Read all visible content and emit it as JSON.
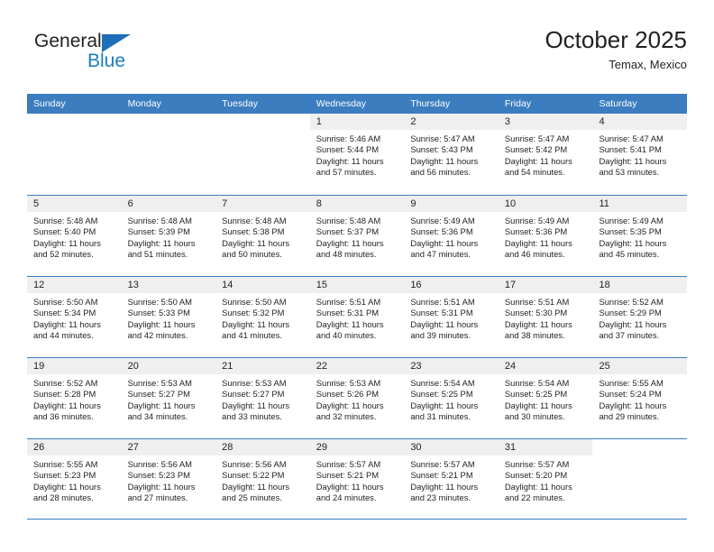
{
  "logo": {
    "word_one": "General",
    "word_two": "Blue",
    "icon": "triangle-icon",
    "brand_color": "#1a7fc1"
  },
  "header": {
    "title": "October 2025",
    "subtitle": "Temax, Mexico"
  },
  "theme": {
    "header_blue": "#3b7dbf",
    "daynum_band": "#efefef",
    "text": "#231f20"
  },
  "calendar": {
    "weekdays": [
      "Sunday",
      "Monday",
      "Tuesday",
      "Wednesday",
      "Thursday",
      "Friday",
      "Saturday"
    ],
    "weeks": [
      [
        {
          "day": "",
          "empty": true
        },
        {
          "day": "",
          "empty": true
        },
        {
          "day": "",
          "empty": true
        },
        {
          "day": "1",
          "sunrise": "Sunrise: 5:46 AM",
          "sunset": "Sunset: 5:44 PM",
          "daylight_1": "Daylight: 11 hours",
          "daylight_2": "and 57 minutes."
        },
        {
          "day": "2",
          "sunrise": "Sunrise: 5:47 AM",
          "sunset": "Sunset: 5:43 PM",
          "daylight_1": "Daylight: 11 hours",
          "daylight_2": "and 56 minutes."
        },
        {
          "day": "3",
          "sunrise": "Sunrise: 5:47 AM",
          "sunset": "Sunset: 5:42 PM",
          "daylight_1": "Daylight: 11 hours",
          "daylight_2": "and 54 minutes."
        },
        {
          "day": "4",
          "sunrise": "Sunrise: 5:47 AM",
          "sunset": "Sunset: 5:41 PM",
          "daylight_1": "Daylight: 11 hours",
          "daylight_2": "and 53 minutes."
        }
      ],
      [
        {
          "day": "5",
          "sunrise": "Sunrise: 5:48 AM",
          "sunset": "Sunset: 5:40 PM",
          "daylight_1": "Daylight: 11 hours",
          "daylight_2": "and 52 minutes."
        },
        {
          "day": "6",
          "sunrise": "Sunrise: 5:48 AM",
          "sunset": "Sunset: 5:39 PM",
          "daylight_1": "Daylight: 11 hours",
          "daylight_2": "and 51 minutes."
        },
        {
          "day": "7",
          "sunrise": "Sunrise: 5:48 AM",
          "sunset": "Sunset: 5:38 PM",
          "daylight_1": "Daylight: 11 hours",
          "daylight_2": "and 50 minutes."
        },
        {
          "day": "8",
          "sunrise": "Sunrise: 5:48 AM",
          "sunset": "Sunset: 5:37 PM",
          "daylight_1": "Daylight: 11 hours",
          "daylight_2": "and 48 minutes."
        },
        {
          "day": "9",
          "sunrise": "Sunrise: 5:49 AM",
          "sunset": "Sunset: 5:36 PM",
          "daylight_1": "Daylight: 11 hours",
          "daylight_2": "and 47 minutes."
        },
        {
          "day": "10",
          "sunrise": "Sunrise: 5:49 AM",
          "sunset": "Sunset: 5:36 PM",
          "daylight_1": "Daylight: 11 hours",
          "daylight_2": "and 46 minutes."
        },
        {
          "day": "11",
          "sunrise": "Sunrise: 5:49 AM",
          "sunset": "Sunset: 5:35 PM",
          "daylight_1": "Daylight: 11 hours",
          "daylight_2": "and 45 minutes."
        }
      ],
      [
        {
          "day": "12",
          "sunrise": "Sunrise: 5:50 AM",
          "sunset": "Sunset: 5:34 PM",
          "daylight_1": "Daylight: 11 hours",
          "daylight_2": "and 44 minutes."
        },
        {
          "day": "13",
          "sunrise": "Sunrise: 5:50 AM",
          "sunset": "Sunset: 5:33 PM",
          "daylight_1": "Daylight: 11 hours",
          "daylight_2": "and 42 minutes."
        },
        {
          "day": "14",
          "sunrise": "Sunrise: 5:50 AM",
          "sunset": "Sunset: 5:32 PM",
          "daylight_1": "Daylight: 11 hours",
          "daylight_2": "and 41 minutes."
        },
        {
          "day": "15",
          "sunrise": "Sunrise: 5:51 AM",
          "sunset": "Sunset: 5:31 PM",
          "daylight_1": "Daylight: 11 hours",
          "daylight_2": "and 40 minutes."
        },
        {
          "day": "16",
          "sunrise": "Sunrise: 5:51 AM",
          "sunset": "Sunset: 5:31 PM",
          "daylight_1": "Daylight: 11 hours",
          "daylight_2": "and 39 minutes."
        },
        {
          "day": "17",
          "sunrise": "Sunrise: 5:51 AM",
          "sunset": "Sunset: 5:30 PM",
          "daylight_1": "Daylight: 11 hours",
          "daylight_2": "and 38 minutes."
        },
        {
          "day": "18",
          "sunrise": "Sunrise: 5:52 AM",
          "sunset": "Sunset: 5:29 PM",
          "daylight_1": "Daylight: 11 hours",
          "daylight_2": "and 37 minutes."
        }
      ],
      [
        {
          "day": "19",
          "sunrise": "Sunrise: 5:52 AM",
          "sunset": "Sunset: 5:28 PM",
          "daylight_1": "Daylight: 11 hours",
          "daylight_2": "and 36 minutes."
        },
        {
          "day": "20",
          "sunrise": "Sunrise: 5:53 AM",
          "sunset": "Sunset: 5:27 PM",
          "daylight_1": "Daylight: 11 hours",
          "daylight_2": "and 34 minutes."
        },
        {
          "day": "21",
          "sunrise": "Sunrise: 5:53 AM",
          "sunset": "Sunset: 5:27 PM",
          "daylight_1": "Daylight: 11 hours",
          "daylight_2": "and 33 minutes."
        },
        {
          "day": "22",
          "sunrise": "Sunrise: 5:53 AM",
          "sunset": "Sunset: 5:26 PM",
          "daylight_1": "Daylight: 11 hours",
          "daylight_2": "and 32 minutes."
        },
        {
          "day": "23",
          "sunrise": "Sunrise: 5:54 AM",
          "sunset": "Sunset: 5:25 PM",
          "daylight_1": "Daylight: 11 hours",
          "daylight_2": "and 31 minutes."
        },
        {
          "day": "24",
          "sunrise": "Sunrise: 5:54 AM",
          "sunset": "Sunset: 5:25 PM",
          "daylight_1": "Daylight: 11 hours",
          "daylight_2": "and 30 minutes."
        },
        {
          "day": "25",
          "sunrise": "Sunrise: 5:55 AM",
          "sunset": "Sunset: 5:24 PM",
          "daylight_1": "Daylight: 11 hours",
          "daylight_2": "and 29 minutes."
        }
      ],
      [
        {
          "day": "26",
          "sunrise": "Sunrise: 5:55 AM",
          "sunset": "Sunset: 5:23 PM",
          "daylight_1": "Daylight: 11 hours",
          "daylight_2": "and 28 minutes."
        },
        {
          "day": "27",
          "sunrise": "Sunrise: 5:56 AM",
          "sunset": "Sunset: 5:23 PM",
          "daylight_1": "Daylight: 11 hours",
          "daylight_2": "and 27 minutes."
        },
        {
          "day": "28",
          "sunrise": "Sunrise: 5:56 AM",
          "sunset": "Sunset: 5:22 PM",
          "daylight_1": "Daylight: 11 hours",
          "daylight_2": "and 25 minutes."
        },
        {
          "day": "29",
          "sunrise": "Sunrise: 5:57 AM",
          "sunset": "Sunset: 5:21 PM",
          "daylight_1": "Daylight: 11 hours",
          "daylight_2": "and 24 minutes."
        },
        {
          "day": "30",
          "sunrise": "Sunrise: 5:57 AM",
          "sunset": "Sunset: 5:21 PM",
          "daylight_1": "Daylight: 11 hours",
          "daylight_2": "and 23 minutes."
        },
        {
          "day": "31",
          "sunrise": "Sunrise: 5:57 AM",
          "sunset": "Sunset: 5:20 PM",
          "daylight_1": "Daylight: 11 hours",
          "daylight_2": "and 22 minutes."
        },
        {
          "day": "",
          "empty": true
        }
      ]
    ]
  }
}
